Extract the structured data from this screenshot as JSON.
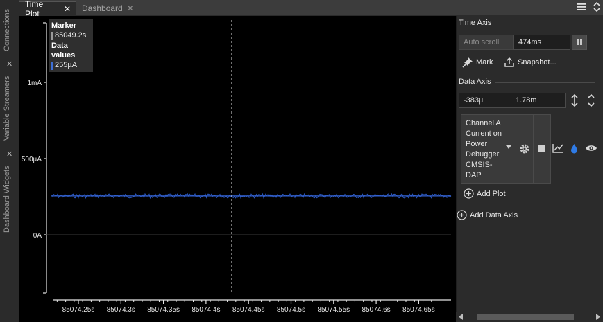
{
  "tabs": [
    {
      "label": "Time Plot",
      "active": true
    },
    {
      "label": "Dashboard",
      "active": false
    }
  ],
  "close_glyph": "✕",
  "left_dock": {
    "tabs": [
      "Connections",
      "Variable Streamers",
      "Dashboard Widgets"
    ]
  },
  "plot": {
    "marker_box": {
      "marker_title": "Marker",
      "marker_value": "85049.2s",
      "data_title": "Data values",
      "data_value": "255µA"
    },
    "y_ticks": [
      {
        "label": "1mA",
        "value": 1.0
      },
      {
        "label": "500µA",
        "value": 0.5
      },
      {
        "label": "0A",
        "value": 0.0
      }
    ],
    "x_ticks": [
      "85074.25s",
      "85074.3s",
      "85074.35s",
      "85074.4s",
      "85074.45s",
      "85074.5s",
      "85074.55s",
      "85074.6s",
      "85074.65s"
    ],
    "signal_level_mA": 0.255,
    "y_range_mA": [
      -0.383,
      1.3
    ],
    "colors": {
      "signal": "#2f5fd0",
      "background": "#000000",
      "marker_line": "#e0e0e0"
    }
  },
  "right_panel": {
    "time_axis_title": "Time Axis",
    "auto_scroll_label": "Auto scroll",
    "time_window_value": "474ms",
    "pause_icon": "pause-icon",
    "mark_label": "Mark",
    "snapshot_label": "Snapshot...",
    "data_axis_title": "Data Axis",
    "data_axis_min": "-383µ",
    "data_axis_max": "1.78m",
    "channel_label": "Channel A Current on Power Debugger CMSIS-DAP",
    "add_plot_label": "Add Plot",
    "add_data_axis_label": "Add Data Axis"
  }
}
